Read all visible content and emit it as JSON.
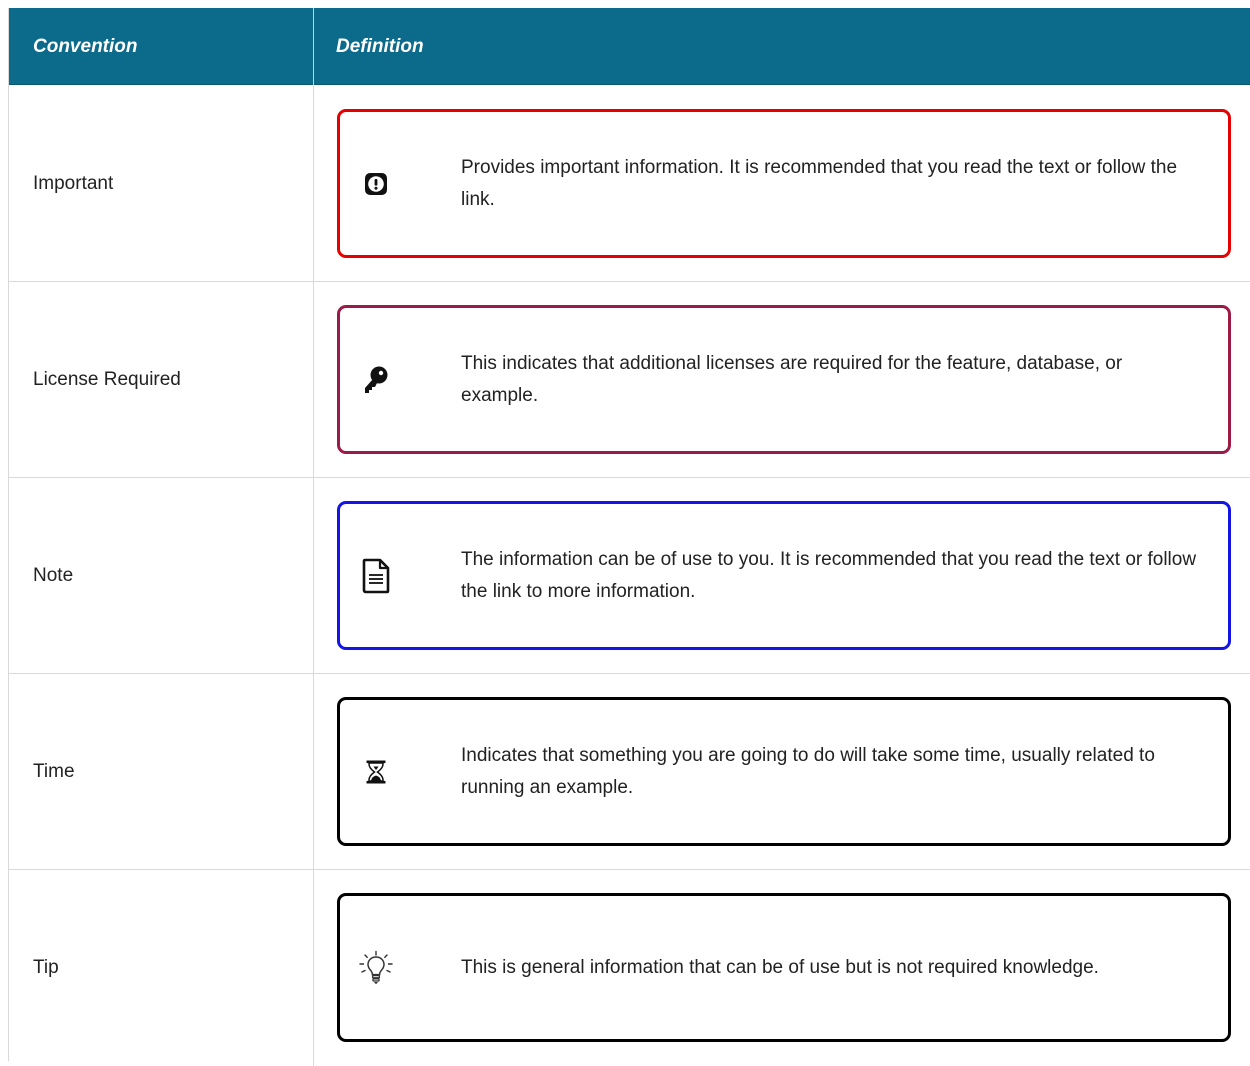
{
  "header": {
    "convention": "Convention",
    "definition": "Definition"
  },
  "rows": [
    {
      "convention": "Important",
      "definition": "Provides important information. It is recommended that you read the text or follow the link.",
      "icon": "exclamation-icon",
      "border_color": "#e60000"
    },
    {
      "convention": "License Required",
      "definition": "This indicates that additional licenses are required for the feature, database, or example.",
      "icon": "key-icon",
      "border_color": "#9b1b45"
    },
    {
      "convention": "Note",
      "definition": "The information can be of use to you. It is recommended that you read the text or follow the link to more information.",
      "icon": "document-icon",
      "border_color": "#1414e6"
    },
    {
      "convention": "Time",
      "definition": "Indicates that something you are going to do will take some time, usually related to running an example.",
      "icon": "hourglass-icon",
      "border_color": "#000000"
    },
    {
      "convention": "Tip",
      "definition": "This is general information that can be of use but is not required knowledge.",
      "icon": "lightbulb-icon",
      "border_color": "#000000"
    }
  ],
  "colors": {
    "header_background": "#0c6a8b",
    "header_text": "#ffffff",
    "grid_line": "#d9d9d9"
  }
}
